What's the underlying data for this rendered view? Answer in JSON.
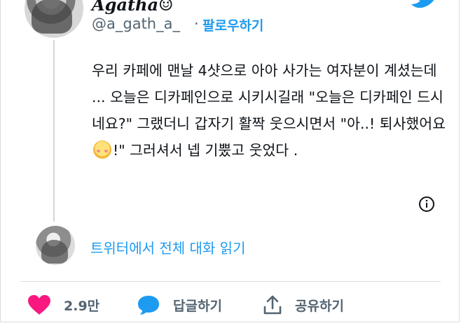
{
  "author": {
    "display_name": "Agatha☺︎",
    "handle": "@a_gath_a_",
    "separator": "·",
    "follow_label": "팔로우하기"
  },
  "tweet": {
    "text_before_emoji": "우리 카페에 맨날 4샷으로 아아 사가는 여자분이 계셨는데 ... 오늘은 디카페인으로 시키시길래 \"오늘은 디카페인 드시네요?\" 그랬더니 갑자기 활짝 웃으시면서 \"아..! 퇴사했어요",
    "emoji": "smiling-face-with-blush",
    "text_after_emoji": "!\" 그러셔서 넵 기뿠고 웃었다 ."
  },
  "thread": {
    "read_full_label": "트위터에서 전체 대화 읽기"
  },
  "actions": {
    "like_count": "2.9만",
    "reply_label": "답글하기",
    "share_label": "공유하기"
  },
  "colors": {
    "accent": "#1d9bf0",
    "like": "#f91880",
    "muted": "#536471"
  },
  "icons": {
    "brand": "twitter-bird-icon",
    "info": "info-icon",
    "like": "heart-icon",
    "reply": "speech-bubble-icon",
    "share": "share-icon"
  }
}
